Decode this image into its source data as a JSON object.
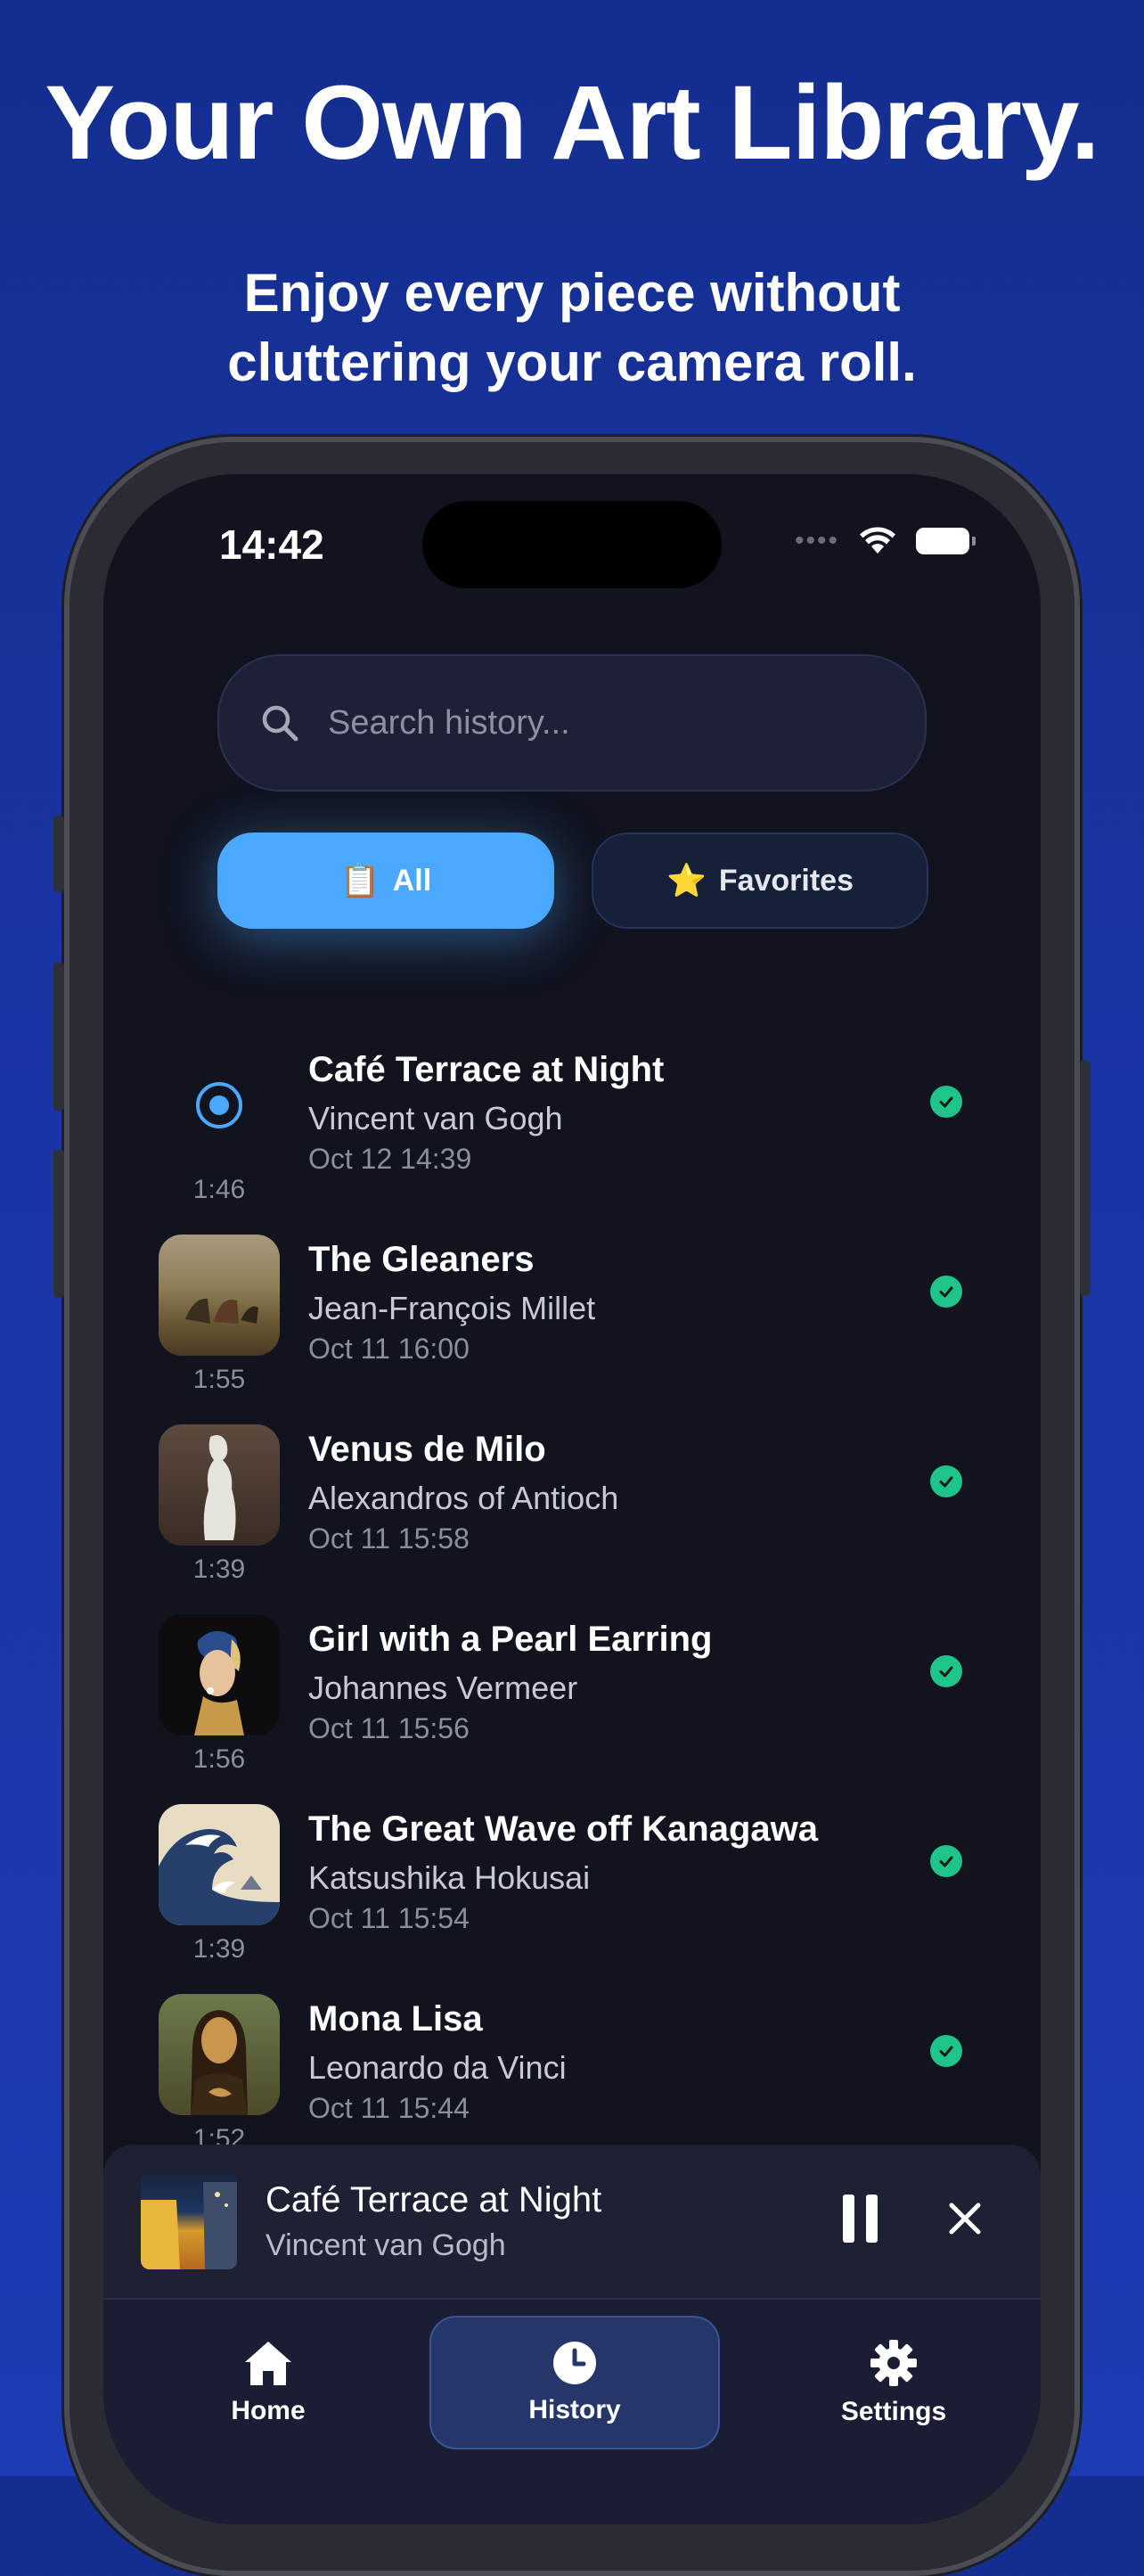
{
  "headline": "Your Own Art Library.",
  "subline_1": "Enjoy every piece without",
  "subline_2": "cluttering your camera roll.",
  "status": {
    "time": "14:42"
  },
  "search": {
    "placeholder": "Search history..."
  },
  "filters": {
    "all": {
      "emoji": "📋",
      "label": "All"
    },
    "favorites": {
      "emoji": "⭐",
      "label": "Favorites"
    }
  },
  "history": [
    {
      "title": "Café Terrace at Night",
      "artist": "Vincent van Gogh",
      "date": "Oct 12 14:39",
      "duration": "1:46",
      "thumb": "playing-icon"
    },
    {
      "title": "The Gleaners",
      "artist": "Jean-François Millet",
      "date": "Oct 11 16:00",
      "duration": "1:55",
      "thumb": "painting"
    },
    {
      "title": "Venus de Milo",
      "artist": "Alexandros of Antioch",
      "date": "Oct 11 15:58",
      "duration": "1:39",
      "thumb": "sculpture"
    },
    {
      "title": "Girl with a Pearl Earring",
      "artist": "Johannes Vermeer",
      "date": "Oct 11 15:56",
      "duration": "1:56",
      "thumb": "painting"
    },
    {
      "title": "The Great Wave off Kanagawa",
      "artist": "Katsushika Hokusai",
      "date": "Oct 11 15:54",
      "duration": "1:39",
      "thumb": "print"
    },
    {
      "title": "Mona Lisa",
      "artist": "Leonardo da Vinci",
      "date": "Oct 11 15:44",
      "duration": "1:52",
      "thumb": "painting"
    }
  ],
  "now_playing": {
    "title": "Café Terrace at Night",
    "artist": "Vincent van Gogh"
  },
  "tabbar": {
    "home": "Home",
    "history": "History",
    "settings": "Settings"
  },
  "colors": {
    "accent": "#4aa8ff",
    "check": "#1ec48a",
    "background": "#1a36a8",
    "screen": "#11131f"
  }
}
